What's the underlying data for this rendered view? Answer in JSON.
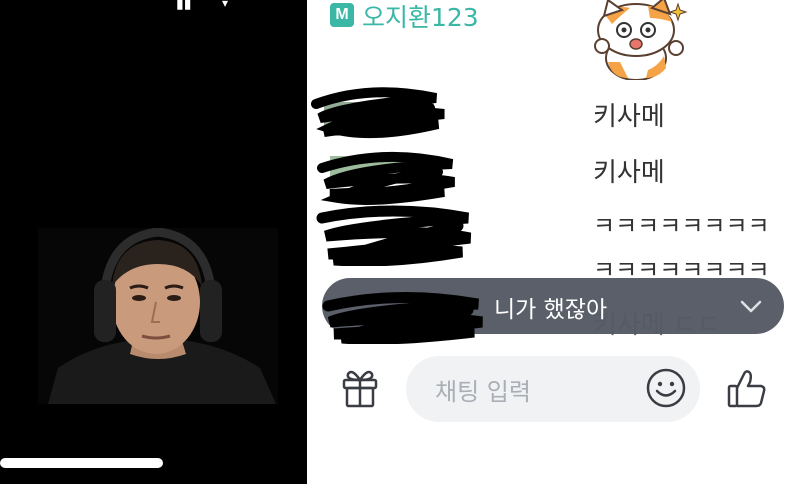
{
  "colors": {
    "accent": "#3ab7a5",
    "video_bg": "#000000",
    "popup_bg": "#555a64",
    "input_bg": "#f1f2f4",
    "placeholder": "#aaaeb5",
    "text": "#333333"
  },
  "stream": {
    "playback_progress": 0.53
  },
  "chat": {
    "top_user": {
      "badge": "M",
      "name": "오지환123",
      "sticker": "cat-sticker"
    },
    "messages": [
      {
        "user_redacted": true,
        "text": "키사메"
      },
      {
        "user_redacted": true,
        "text": "키사메"
      },
      {
        "user_redacted": true,
        "text": "ㅋㅋㅋㅋㅋㅋㅋㅋ"
      },
      {
        "user_redacted": true,
        "text": "ㅋㅋㅋㅋㅋㅋㅋㅋ"
      },
      {
        "user_redacted": true,
        "text": "키사메 ㄷㄷ"
      }
    ],
    "pinned_popup": {
      "text": "니가 했잖아",
      "icon": "chevron-down-icon"
    }
  },
  "input_bar": {
    "placeholder": "채팅 입력",
    "gift_icon": "gift-icon",
    "emoji_icon": "emoji-icon",
    "like_icon": "thumbs-up-icon"
  }
}
